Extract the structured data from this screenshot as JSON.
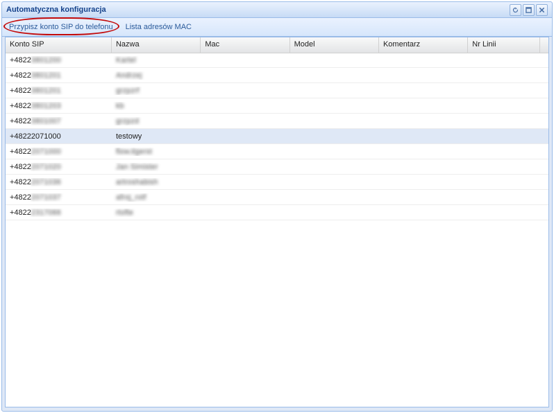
{
  "window": {
    "title": "Automatyczna konfiguracja"
  },
  "tools": {
    "refresh": "refresh-icon",
    "maximize": "maximize-icon",
    "close": "close-icon"
  },
  "toolbar": {
    "assign_sip": "Przypisz konto SIP do telefonu",
    "mac_list": "Lista adresów MAC"
  },
  "columns": {
    "konto_sip": "Konto SIP",
    "nazwa": "Nazwa",
    "mac": "Mac",
    "model": "Model",
    "komentarz": "Komentarz",
    "nr_linii": "Nr Linii"
  },
  "rows": [
    {
      "konto": "+48223801200",
      "nazwa": "Kartel",
      "mac": "",
      "model": "",
      "komentarz": "",
      "nr": "",
      "clear": false,
      "clear_k": false
    },
    {
      "konto": "+48223801201",
      "nazwa": "Andrzej",
      "mac": "",
      "model": "",
      "komentarz": "",
      "nr": "",
      "clear": false,
      "clear_k": false
    },
    {
      "konto": "+48223801201",
      "nazwa": "grzpzrf",
      "mac": "",
      "model": "",
      "komentarz": "",
      "nr": "",
      "clear": false,
      "clear_k": false
    },
    {
      "konto": "+48223801203",
      "nazwa": "kb",
      "mac": "",
      "model": "",
      "komentarz": "",
      "nr": "",
      "clear": false,
      "clear_k": false
    },
    {
      "konto": "+48223801007",
      "nazwa": "grzpzd",
      "mac": "",
      "model": "",
      "komentarz": "",
      "nr": "",
      "clear": false,
      "clear_k": false
    },
    {
      "konto": "+48222071000",
      "nazwa": "testowy",
      "mac": "",
      "model": "",
      "komentarz": "",
      "nr": "",
      "clear": true,
      "clear_k": true,
      "selected": true
    },
    {
      "konto": "+48222071000",
      "nazwa": "flow.itgerst",
      "mac": "",
      "model": "",
      "komentarz": "",
      "nr": "",
      "clear": false,
      "clear_k": false
    },
    {
      "konto": "+48222071020",
      "nazwa": "Jan Simister",
      "mac": "",
      "model": "",
      "komentarz": "",
      "nr": "",
      "clear": false,
      "clear_k": false
    },
    {
      "konto": "+48222071036",
      "nazwa": "artroshabish",
      "mac": "",
      "model": "",
      "komentarz": "",
      "nr": "",
      "clear": false,
      "clear_k": false
    },
    {
      "konto": "+48222071037",
      "nazwa": "afroj_rotf",
      "mac": "",
      "model": "",
      "komentarz": "",
      "nr": "",
      "clear": false,
      "clear_k": false
    },
    {
      "konto": "+48222317066",
      "nazwa": "rtofte",
      "mac": "",
      "model": "",
      "komentarz": "",
      "nr": "",
      "clear": false,
      "clear_k": false
    }
  ]
}
